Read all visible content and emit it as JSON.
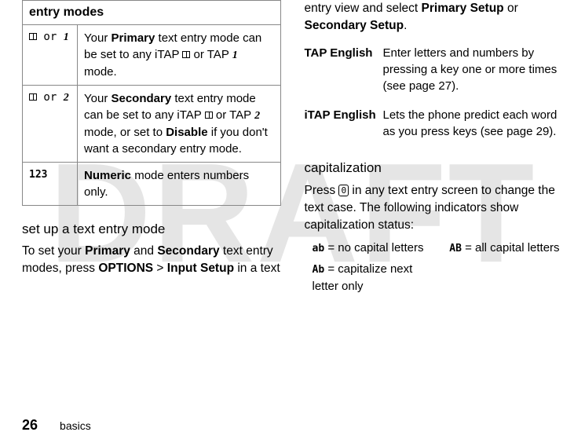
{
  "watermark": "DRAFT",
  "modes_table": {
    "header": "entry modes",
    "rows": [
      {
        "icon_text": " or ",
        "icon1": "book",
        "icon2": "1",
        "desc_parts": [
          "Your ",
          "Primary",
          " text entry mode can be set to any iTAP ",
          "book",
          " or TAP ",
          "1",
          " mode."
        ]
      },
      {
        "icon_text": " or ",
        "icon1": "book",
        "icon2": "2",
        "desc_parts": [
          "Your ",
          "Secondary",
          " text entry mode can be set to any iTAP ",
          "book",
          " or TAP ",
          "2",
          " mode, or set to ",
          "Disable",
          " if you don't want a secondary entry mode."
        ]
      },
      {
        "icon_plain": "123",
        "desc_parts": [
          "",
          "Numeric",
          " mode enters numbers only."
        ]
      }
    ]
  },
  "setup_heading": "set up a text entry mode",
  "setup_para": {
    "pre": "To set your ",
    "b1": "Primary",
    "mid1": " and ",
    "b2": "Secondary",
    "mid2": " text entry modes, press ",
    "b3": "OPTIONS",
    "sep": " > ",
    "b4": "Input Setup",
    "post": " in a text"
  },
  "right_intro": {
    "pre": "entry view and select ",
    "b1": "Primary Setup",
    "mid": " or ",
    "b2": "Secondary Setup",
    "post": "."
  },
  "setup_table": [
    {
      "label": "TAP English",
      "desc": "Enter letters and numbers by pressing a key one or more times (see page 27)."
    },
    {
      "label": "iTAP English",
      "desc": "Lets the phone predict each word as you press keys (see page 29)."
    }
  ],
  "cap_heading": "capitalization",
  "cap_para": {
    "pre": "Press ",
    "key": "0",
    "post": " in any text entry screen to change the text case. The following indicators show capitalization status:"
  },
  "cap_grid": {
    "r1c1_icon": "ab",
    "r1c1_text": " = no capital letters",
    "r1c2_icon": "AB",
    "r1c2_text": " = all capital letters",
    "r2c1_icon": "Ab",
    "r2c1_text": " = capitalize next letter only"
  },
  "footer": {
    "page": "26",
    "section": "basics"
  }
}
